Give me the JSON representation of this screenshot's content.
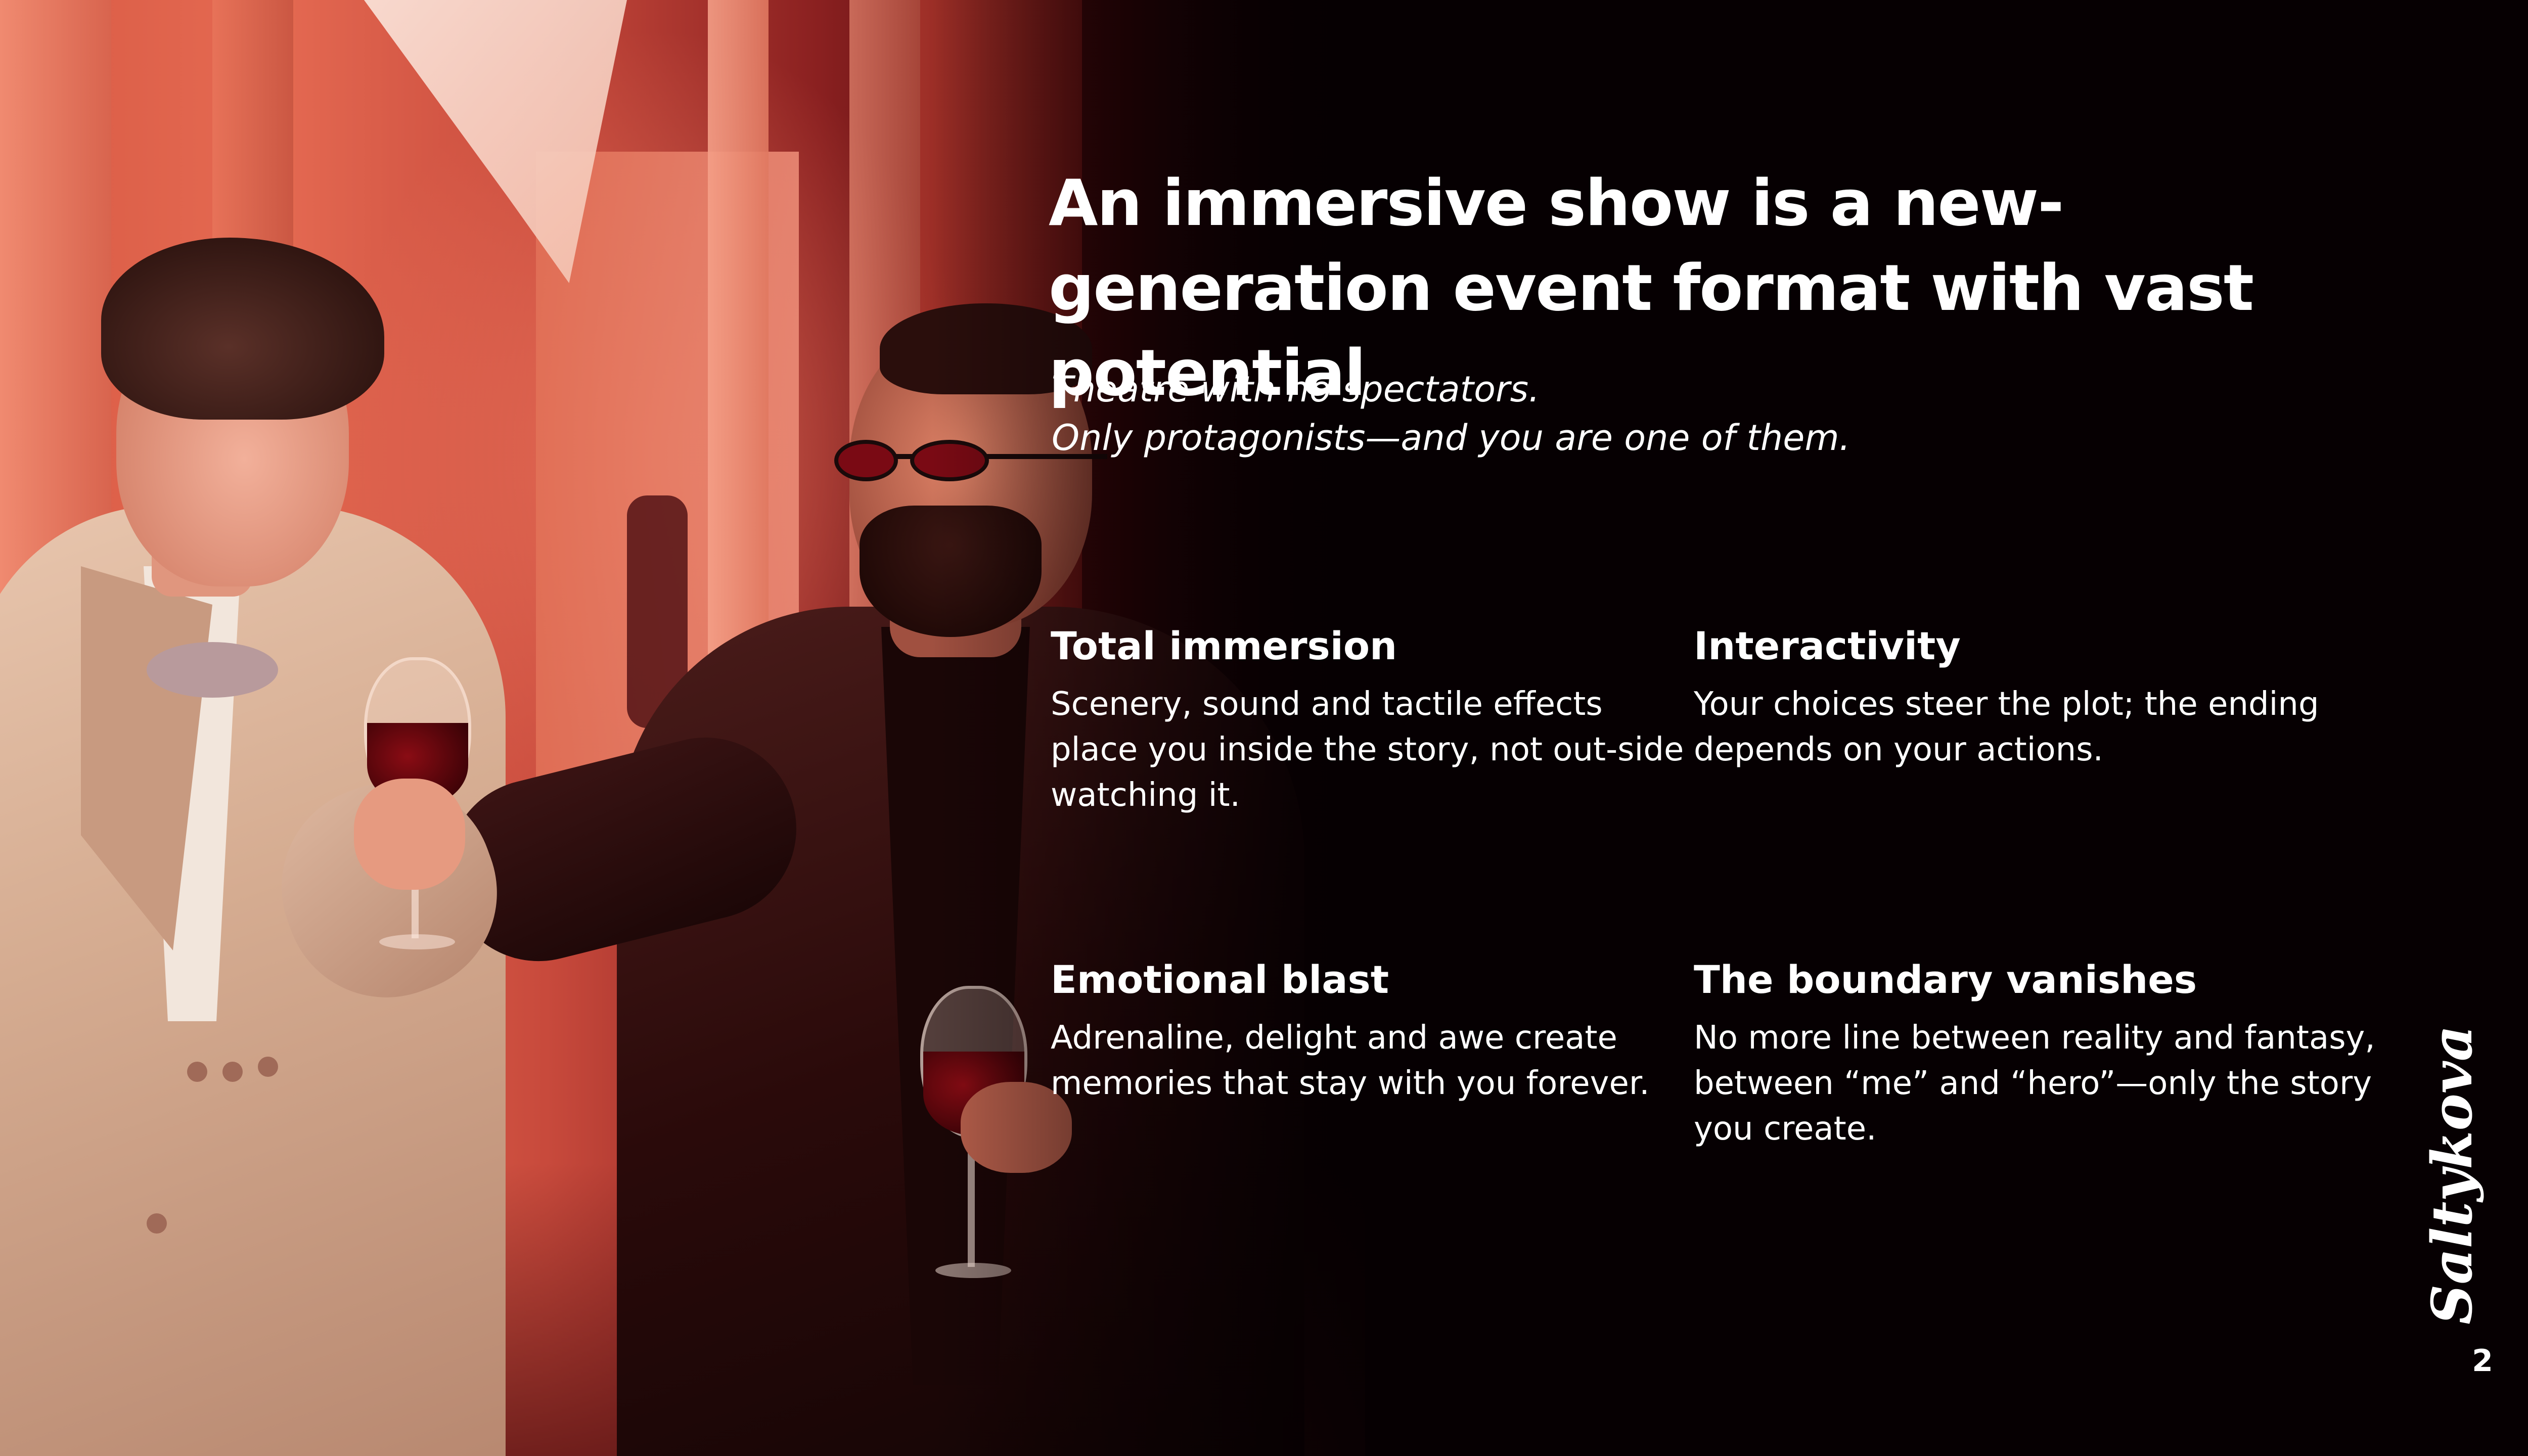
{
  "slide": {
    "title": "An immersive show is a new-generation event format with vast potential",
    "tagline": {
      "line1": "Theatre with no spectators.",
      "line2": "Only protagonists—and you are one of them."
    },
    "features": [
      {
        "heading": "Total immersion",
        "text": "Scenery, sound and tactile effects place you inside the story, not out-side watching it."
      },
      {
        "heading": "Interactivity",
        "text": "Your choices steer the plot; the ending depends on your actions."
      },
      {
        "heading": "Emotional blast",
        "text": "Adrenaline, delight and awe create memories that stay with you forever."
      },
      {
        "heading": "The boundary vanishes",
        "text": "No more line between reality and fantasy, between “me” and “hero”—only the story you create."
      }
    ],
    "signature": "Saltykova",
    "page_number": "2"
  },
  "colors": {
    "background": "#060002",
    "text": "#ffffff",
    "photo_tint": "#e56a52"
  }
}
